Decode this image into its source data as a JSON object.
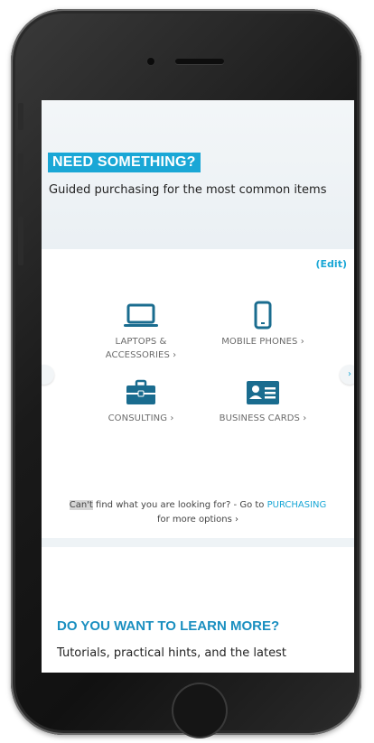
{
  "section_need": {
    "title": "NEED SOMETHING?",
    "subtitle": "Guided purchasing for the most common items"
  },
  "card": {
    "edit_label": "(Edit)",
    "tiles": [
      {
        "label_line1": "LAPTOPS &",
        "label_line2": "ACCESSORIES ›",
        "icon": "laptop-icon"
      },
      {
        "label_line1": "MOBILE PHONES ›",
        "label_line2": "",
        "icon": "mobile-phone-icon"
      },
      {
        "label_line1": "CONSULTING ›",
        "label_line2": "",
        "icon": "briefcase-icon"
      },
      {
        "label_line1": "BUSINESS CARDS ›",
        "label_line2": "",
        "icon": "business-card-icon"
      }
    ],
    "footer": {
      "highlight": "Can't",
      "text_before_link": " find what you are looking for? - Go to ",
      "link": "PURCHASING",
      "text_after": "for more options ›"
    },
    "arrow_right": "›"
  },
  "section_learn": {
    "title": "DO YOU WANT TO LEARN MORE?",
    "subtitle": "Tutorials, practical hints, and the latest"
  },
  "colors": {
    "accent": "#1aa7d6",
    "icon": "#1a6c8f",
    "heading_blue": "#1a8fc0"
  }
}
